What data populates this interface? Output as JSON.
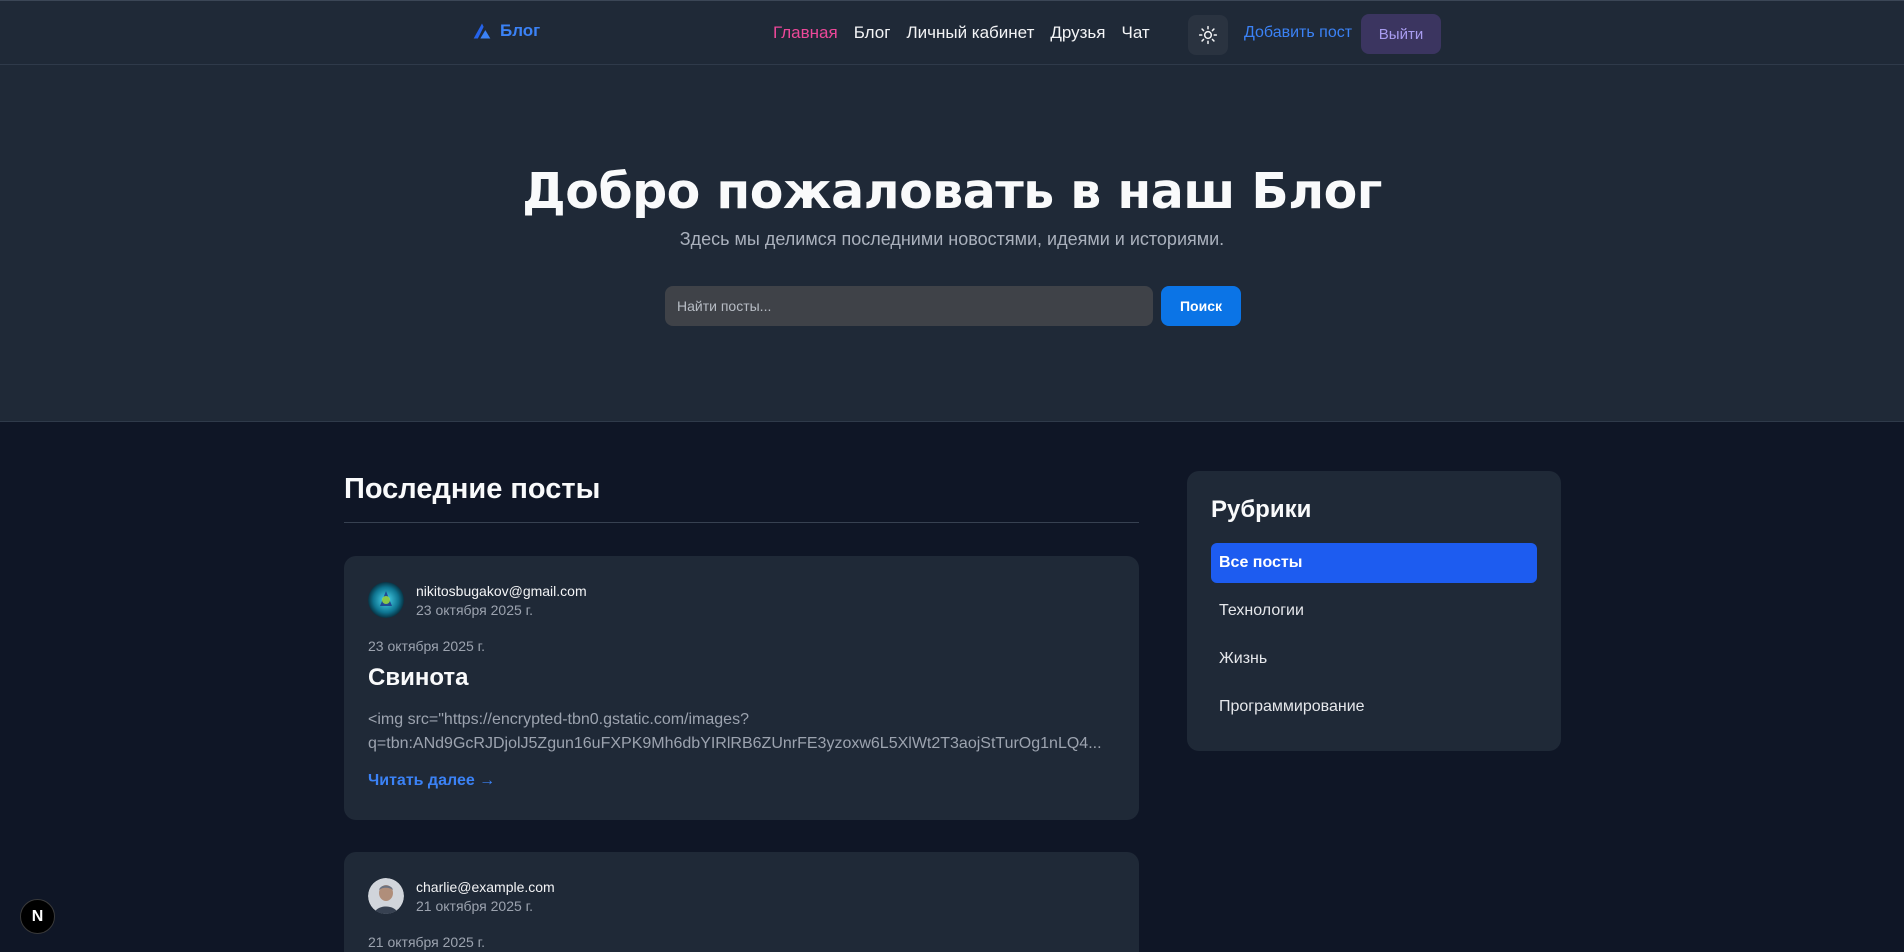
{
  "header": {
    "logo_text": "Блог",
    "nav": [
      {
        "label": "Главная",
        "active": true
      },
      {
        "label": "Блог",
        "active": false
      },
      {
        "label": "Личный кабинет",
        "active": false
      },
      {
        "label": "Друзья",
        "active": false
      },
      {
        "label": "Чат",
        "active": false
      }
    ],
    "theme_toggle_icon": "sun-icon",
    "add_post_label": "Добавить пост",
    "logout_label": "Выйти"
  },
  "hero": {
    "title": "Добро пожаловать в наш Блог",
    "subtitle": "Здесь мы делимся последними новостями, идеями и историями.",
    "search_placeholder": "Найти посты...",
    "search_button": "Поиск"
  },
  "posts": {
    "title": "Последние посты",
    "items": [
      {
        "author": "nikitosbugakov@gmail.com",
        "author_date": "23 октября 2025 г.",
        "date": "23 октября 2025 г.",
        "title": "Свинота",
        "excerpt_line1": "<img src=\"https://encrypted-tbn0.gstatic.com/images?",
        "excerpt_line2": "q=tbn:ANd9GcRJDjolJ5Zgun16uFXPK9Mh6dbYIRlRB6ZUnrFE3yzoxw6L5XlWt2T3aojStTurOg1nLQ4...",
        "read_more": "Читать далее →"
      },
      {
        "author": "charlie@example.com",
        "author_date": "21 октября 2025 г.",
        "date": "21 октября 2025 г."
      }
    ]
  },
  "sidebar": {
    "title": "Рубрики",
    "categories": [
      {
        "label": "Все посты",
        "active": true
      },
      {
        "label": "Технологии",
        "active": false
      },
      {
        "label": "Жизнь",
        "active": false
      },
      {
        "label": "Программирование",
        "active": false
      }
    ]
  },
  "badge": {
    "label": "N"
  },
  "colors": {
    "accent": "#3b82f6",
    "active_nav": "#ec4899",
    "background": "#0f1626",
    "card": "#1f2937"
  }
}
